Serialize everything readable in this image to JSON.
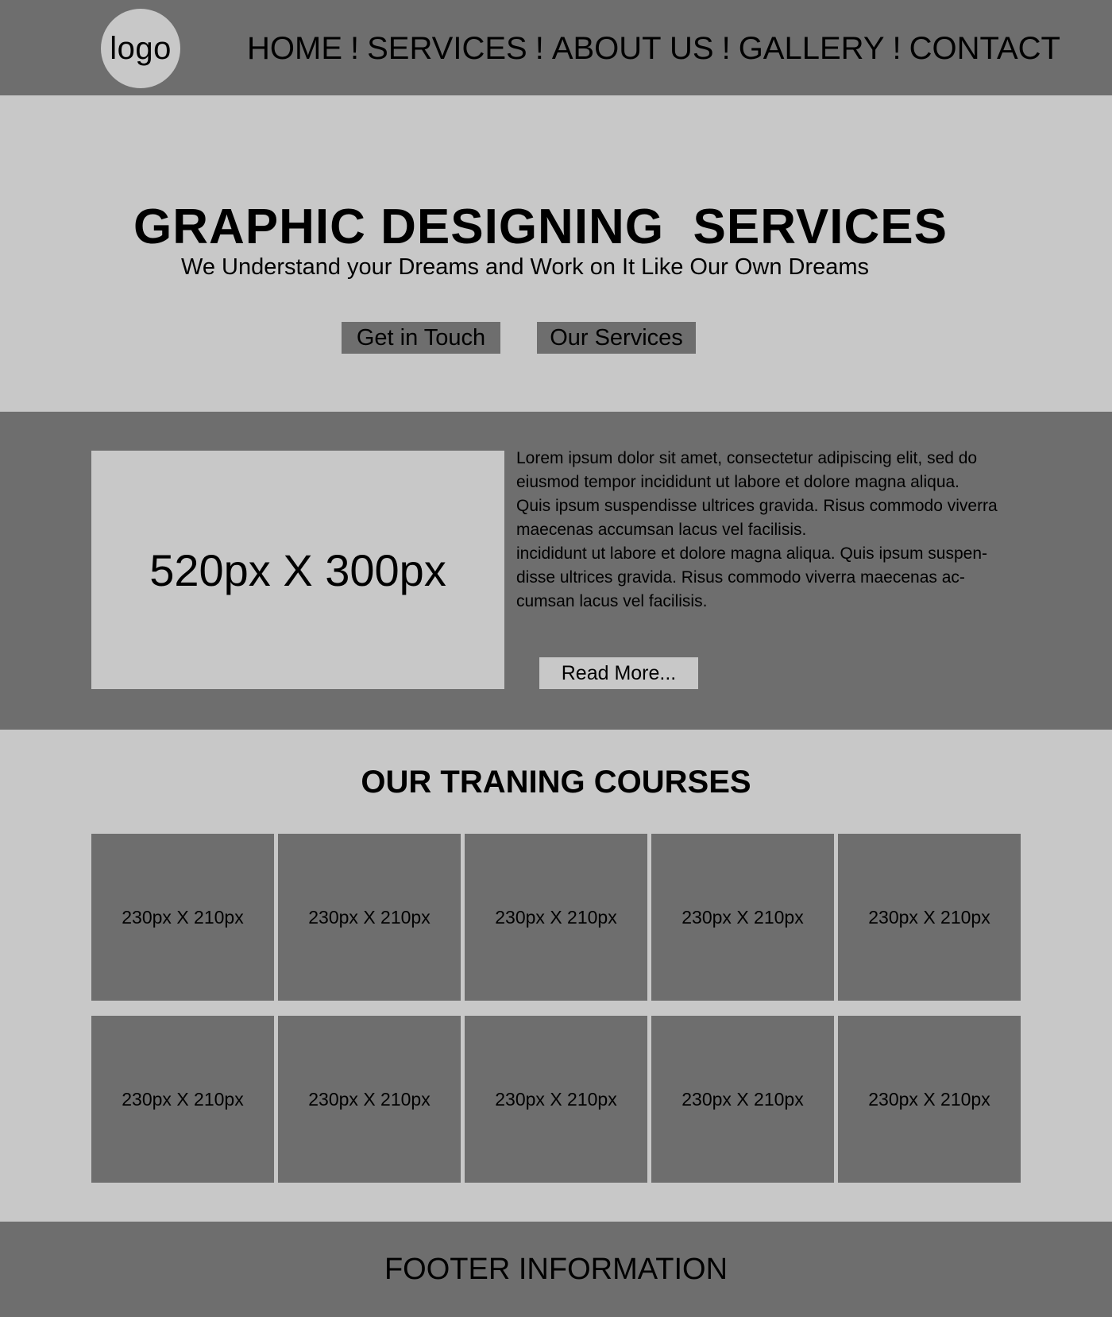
{
  "header": {
    "logo_text": "logo",
    "nav": [
      "HOME",
      "SERVICES",
      "ABOUT US",
      "GALLERY",
      "CONTACT"
    ],
    "separator": "!"
  },
  "hero": {
    "title": "GRAPHIC DESIGNING  SERVICES",
    "subtitle": "We Understand your Dreams and Work on It Like Our Own Dreams",
    "primary_button": "Get in Touch",
    "secondary_button": "Our Services"
  },
  "about": {
    "image_placeholder": "520px X 300px",
    "paragraph_lines": [
      "Lorem ipsum dolor sit amet, consectetur adipiscing elit, sed do",
      "eiusmod tempor incididunt ut labore et dolore magna aliqua.",
      "Quis ipsum suspendisse ultrices gravida. Risus commodo viverra",
      "maecenas accumsan lacus vel facilisis.",
      "incididunt ut labore et dolore magna aliqua. Quis ipsum suspen-",
      "disse ultrices gravida. Risus commodo viverra maecenas ac-",
      "cumsan lacus vel facilisis."
    ],
    "read_more": "Read More..."
  },
  "courses": {
    "title": "OUR TRANING COURSES",
    "items": [
      "230px X 210px",
      "230px X 210px",
      "230px X 210px",
      "230px X 210px",
      "230px X 210px",
      "230px X 210px",
      "230px X 210px",
      "230px X 210px",
      "230px X 210px",
      "230px X 210px"
    ]
  },
  "footer": {
    "text": "FOOTER INFORMATION"
  },
  "colors": {
    "dark_gray": "#6e6e6e",
    "light_gray": "#c8c8c8",
    "text": "#000000"
  }
}
